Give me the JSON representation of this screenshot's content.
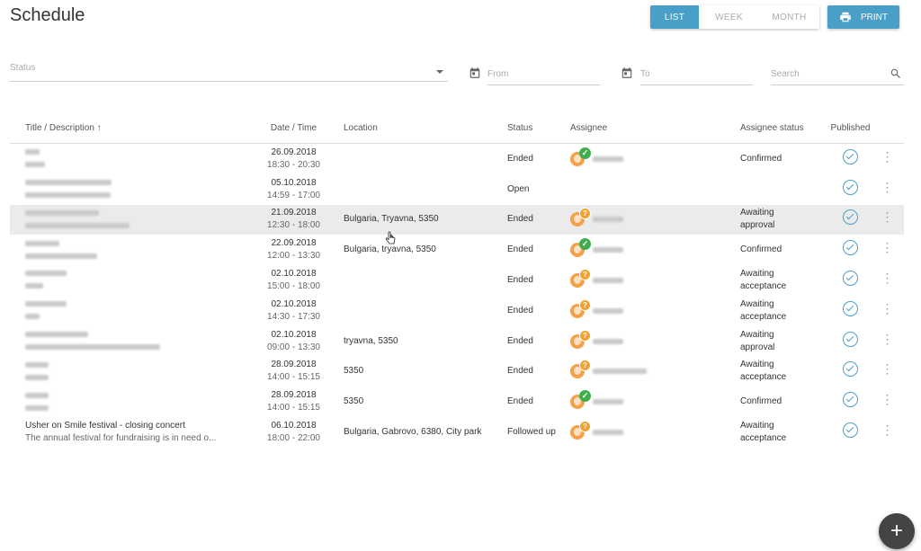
{
  "header": {
    "title": "Schedule",
    "views": [
      "LIST",
      "WEEK",
      "MONTH"
    ],
    "active_view": "LIST",
    "print_label": "PRINT"
  },
  "filters": {
    "status_placeholder": "Status",
    "from_placeholder": "From",
    "to_placeholder": "To",
    "search_placeholder": "Search"
  },
  "table": {
    "columns": [
      "Title / Description",
      "Date / Time",
      "Location",
      "Status",
      "Assignee",
      "Assignee status",
      "Published"
    ],
    "sort_indicator": "↑",
    "rows": [
      {
        "title": "",
        "desc": "",
        "date": "26.09.2018",
        "time": "18:30 - 20:30",
        "location": "",
        "status": "Ended",
        "badge": "check",
        "assignee_status_1": "Confirmed",
        "assignee_status_2": ""
      },
      {
        "title": "",
        "desc": "",
        "date": "05.10.2018",
        "time": "14:59 - 17:00",
        "location": "",
        "status": "Open",
        "badge": "",
        "assignee_status_1": "",
        "assignee_status_2": ""
      },
      {
        "title": "",
        "desc": "",
        "date": "21.09.2018",
        "time": "12:30 - 18:00",
        "location": "Bulgaria, Tryavna, 5350",
        "status": "Ended",
        "badge": "question",
        "assignee_status_1": "Awaiting",
        "assignee_status_2": "approval"
      },
      {
        "title": "",
        "desc": "",
        "date": "22.09.2018",
        "time": "12:00 - 13:30",
        "location": "Bulgaria, tryavna, 5350",
        "status": "Ended",
        "badge": "check",
        "assignee_status_1": "Confirmed",
        "assignee_status_2": ""
      },
      {
        "title": "",
        "desc": "",
        "date": "02.10.2018",
        "time": "15:00 - 18:00",
        "location": "",
        "status": "Ended",
        "badge": "question",
        "assignee_status_1": "Awaiting",
        "assignee_status_2": "acceptance"
      },
      {
        "title": "",
        "desc": "",
        "date": "02.10.2018",
        "time": "14:30 - 17:30",
        "location": "",
        "status": "Ended",
        "badge": "question",
        "assignee_status_1": "Awaiting",
        "assignee_status_2": "acceptance"
      },
      {
        "title": "",
        "desc": "",
        "date": "02.10.2018",
        "time": "09:00 - 13:30",
        "location": "tryavna, 5350",
        "status": "Ended",
        "badge": "question",
        "assignee_status_1": "Awaiting",
        "assignee_status_2": "approval"
      },
      {
        "title": "",
        "desc": "",
        "date": "28.09.2018",
        "time": "14:00 - 15:15",
        "location": "5350",
        "status": "Ended",
        "badge": "question",
        "assignee_status_1": "Awaiting",
        "assignee_status_2": "acceptance"
      },
      {
        "title": "",
        "desc": "",
        "date": "28.09.2018",
        "time": "14:00 - 15:15",
        "location": "5350",
        "status": "Ended",
        "badge": "check",
        "assignee_status_1": "Confirmed",
        "assignee_status_2": ""
      },
      {
        "title": "Usher on Smile festival - closing concert",
        "desc": "The annual festival for fundraising is in need o...",
        "date": "06.10.2018",
        "time": "18:00 - 22:00",
        "location": "Bulgaria, Gabrovo, 6380, City park",
        "status": "Followed up",
        "badge": "question",
        "assignee_status_1": "Awaiting",
        "assignee_status_2": "acceptance"
      }
    ]
  },
  "fab_label": "+",
  "colors": {
    "accent": "#4a9fc9",
    "check_badge": "#3fae4c",
    "question_badge": "#f0a232",
    "fab": "#444444"
  }
}
